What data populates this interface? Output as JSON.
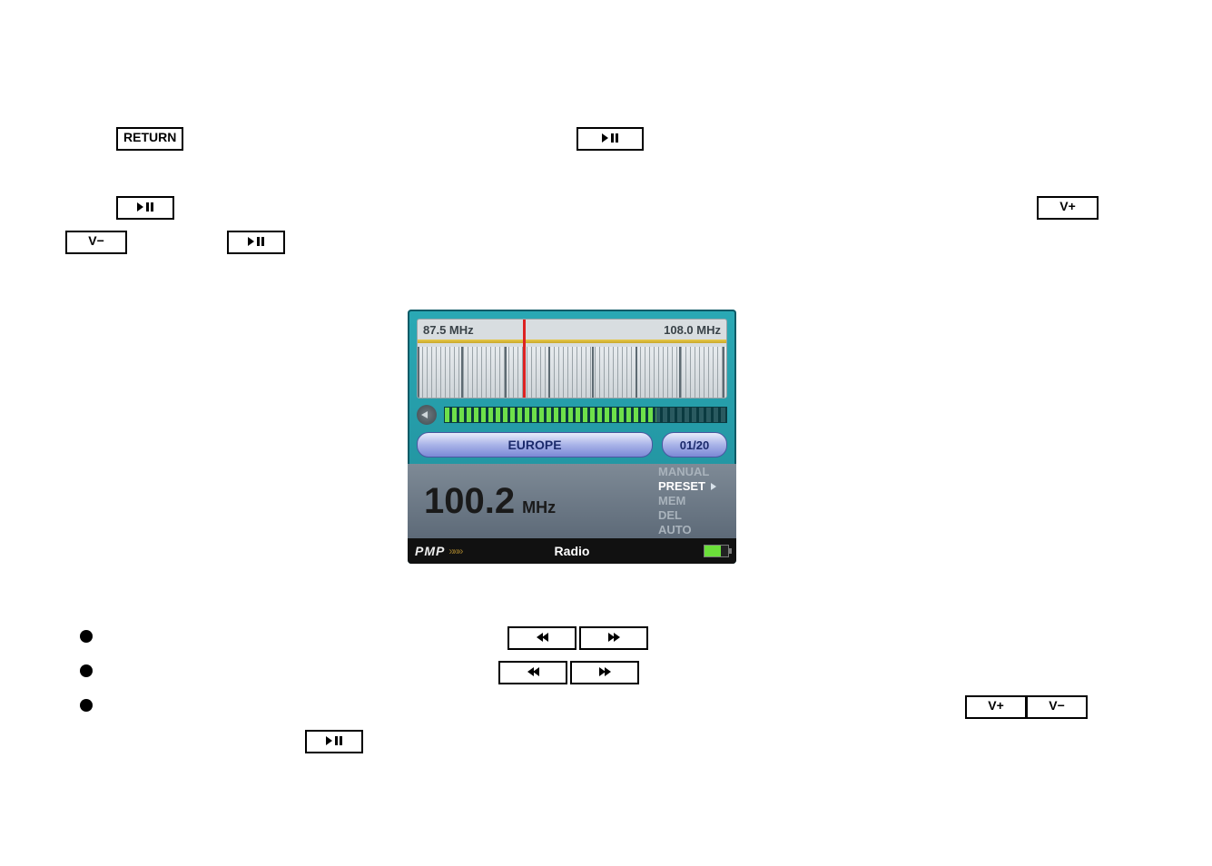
{
  "keys": {
    "return": "RETURN",
    "play_pause": "►/II",
    "vol_up": "V+",
    "vol_down": "V−",
    "rew": "◄◄",
    "fwd": "►►"
  },
  "radio": {
    "dial_min": "87.5 MHz",
    "dial_max": "108.0 MHz",
    "region": "EUROPE",
    "preset_index": "01/20",
    "frequency": "100.2",
    "frequency_unit": "MHz",
    "modes": {
      "manual": "MANUAL",
      "preset": "PRESET",
      "mem": "MEM",
      "del": "DEL",
      "auto": "AUTO"
    },
    "brand": "PMP",
    "chevrons": "»»»",
    "footer_mode": "Radio"
  }
}
